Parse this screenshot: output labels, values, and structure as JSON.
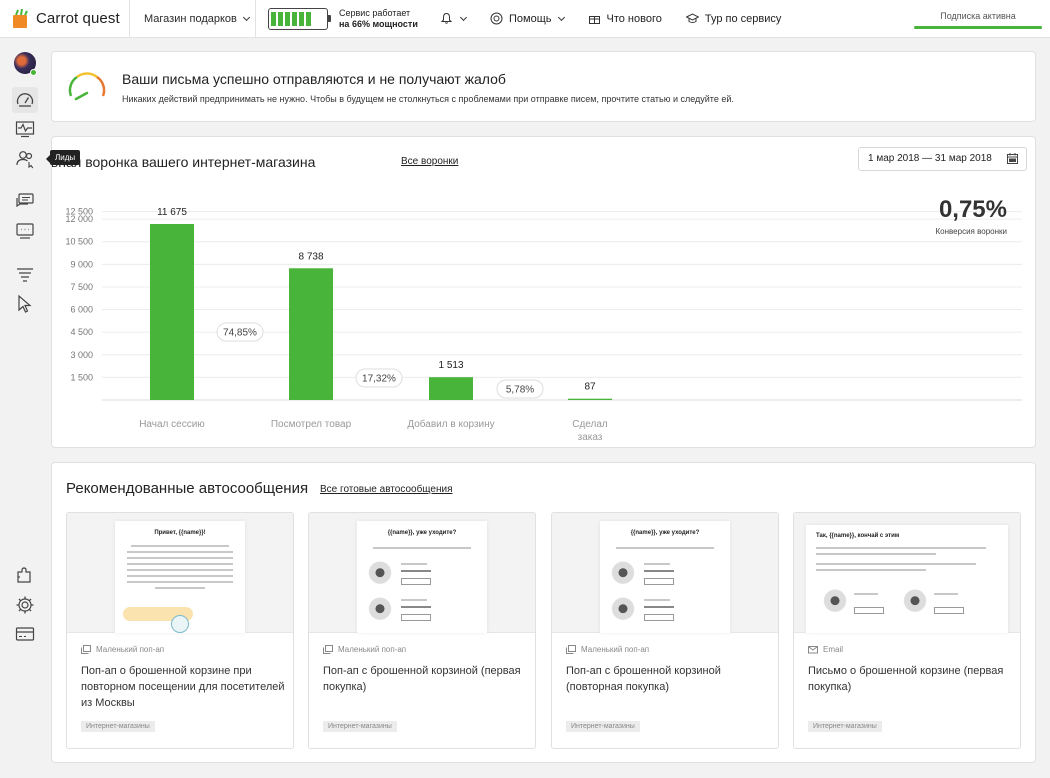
{
  "header": {
    "brand": "Carrot quest",
    "shop": "Магазин подарков",
    "power_line1": "Сервис работает",
    "power_line2": "на 66% мощности",
    "power_level": 0.66,
    "help": "Помощь",
    "whats_new": "Что нового",
    "tour": "Тур по сервису",
    "subscription": "Подписка активна"
  },
  "sidebar": {
    "tooltip": "Лиды"
  },
  "alert": {
    "title": "Ваши письма успешно отправляются и не получают жалоб",
    "text": "Никаких действий предпринимать не нужно. Чтобы в будущем не столкнуться с проблемами при отправке писем, прочтите статью и следуйте ей."
  },
  "funnel": {
    "title": "овная воронка вашего интернет-магазина",
    "link": "Все воронки",
    "date_range": "1 мар 2018 — 31 мар 2018",
    "conversion_value": "0,75%",
    "conversion_label": "Конверсия воронки"
  },
  "chart_data": {
    "type": "bar",
    "categories": [
      "Начал сессию",
      "Посмотрел товар",
      "Добавил в корзину",
      "Сделал заказ"
    ],
    "values": [
      11675,
      8738,
      1513,
      87
    ],
    "value_labels": [
      "11 675",
      "8 738",
      "1 513",
      "87"
    ],
    "step_conversions": [
      "74,85%",
      "17,32%",
      "5,78%"
    ],
    "yticks": [
      1500,
      3000,
      4500,
      6000,
      7500,
      9000,
      10500,
      12000,
      12500
    ],
    "ytick_labels": [
      "1 500",
      "3 000",
      "4 500",
      "6 000",
      "7 500",
      "9 000",
      "10 500",
      "12 000",
      "12 500"
    ],
    "color": "#49b43a"
  },
  "recommended": {
    "title": "Рекомендованные автосообщения",
    "link": "Все готовые автосообщения",
    "items": [
      {
        "type": "Маленький поп-ап",
        "title": "Поп-ап о брошенной корзине при повторном посещении для посетителей из Москвы",
        "tag": "Интернет-магазины",
        "preview_title": "Привет, {{name}}!"
      },
      {
        "type": "Маленький поп-ап",
        "title": "Поп-ап с брошенной корзиной (первая покупка)",
        "tag": "Интернет-магазины",
        "preview_title": "{{name}}, уже уходите?"
      },
      {
        "type": "Маленький поп-ап",
        "title": "Поп-ап с брошенной корзиной (повторная покупка)",
        "tag": "Интернет-магазины",
        "preview_title": "{{name}}, уже уходите?"
      },
      {
        "type": "Email",
        "title": "Письмо о брошенной корзине (первая покупка)",
        "tag": "Интернет-магазины",
        "preview_title": "Так, {{name}}, кончай с этим"
      }
    ]
  }
}
